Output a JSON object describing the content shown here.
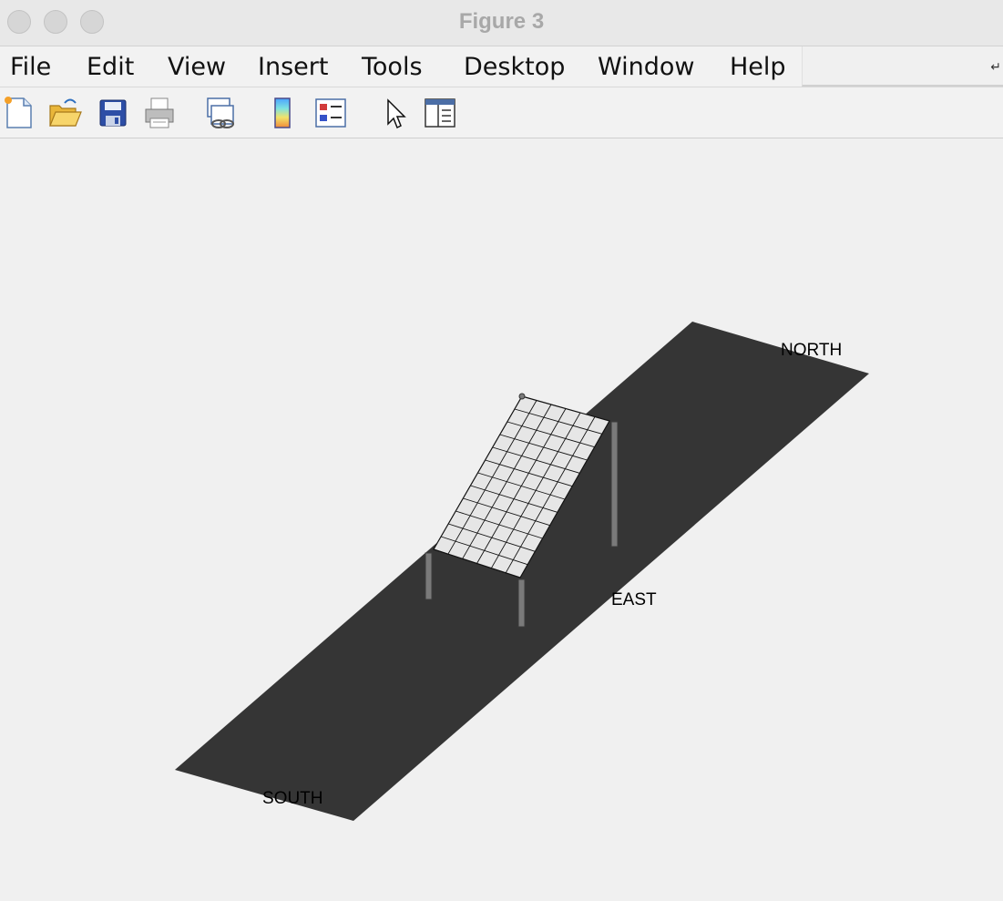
{
  "window": {
    "title": "Figure 3"
  },
  "menu": {
    "items": [
      "File",
      "Edit",
      "View",
      "Insert",
      "Tools",
      "Desktop",
      "Window",
      "Help"
    ]
  },
  "toolbar": {
    "icons": [
      "new-figure-icon",
      "open-file-icon",
      "save-icon",
      "print-icon",
      "link-plot-icon",
      "colorbar-icon",
      "legend-icon",
      "pointer-icon",
      "property-inspector-icon"
    ]
  },
  "scene": {
    "labels": {
      "north": "NORTH",
      "east": "EAST",
      "south": "SOUTH"
    },
    "colors": {
      "ground": "#353535",
      "panel": "#e6e6e6",
      "grid": "#111111",
      "post": "#7a7a7a"
    }
  }
}
